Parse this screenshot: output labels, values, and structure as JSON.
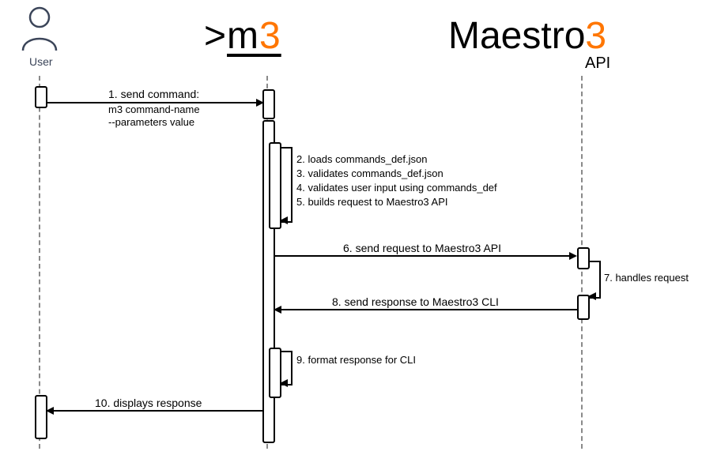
{
  "participants": {
    "user": {
      "label": "User"
    },
    "cli": {
      "prefix": ">",
      "name": "m",
      "num": "3"
    },
    "api": {
      "name": "Maestro",
      "num": "3",
      "sub": "API"
    }
  },
  "messages": {
    "m1a": "1. send command:",
    "m1b": "m3 command-name",
    "m1c": "--parameters value",
    "m2": "2. loads commands_def.json",
    "m3": "3. validates commands_def.json",
    "m4": "4. validates user input using commands_def",
    "m5": "5. builds request to Maestro3 API",
    "m6": "6. send request to Maestro3 API",
    "m7": "7. handles request",
    "m8": "8. send response to Maestro3 CLI",
    "m9": "9. format response for CLI",
    "m10": "10. displays response"
  }
}
